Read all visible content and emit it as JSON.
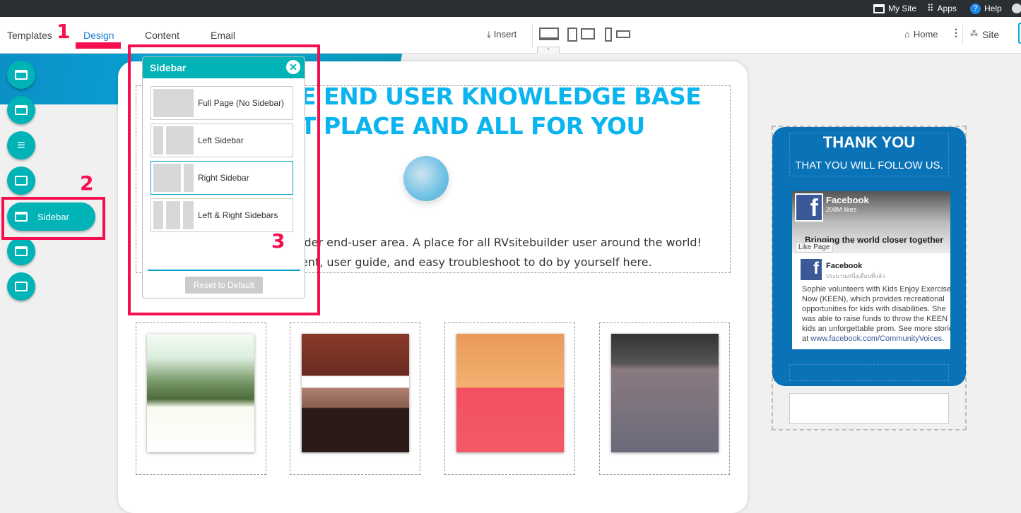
{
  "topbar": {
    "my_site": "My Site",
    "apps": "Apps",
    "help": "Help"
  },
  "toolbar": {
    "tabs": [
      "Templates",
      "Design",
      "Content",
      "Email"
    ],
    "active_tab": "Design",
    "insert": "Insert",
    "home": "Home",
    "site": "Site"
  },
  "annotations": {
    "n1": "1",
    "n2": "2",
    "n3": "3",
    "color": "#f50f4e"
  },
  "rail": {
    "expanded_label": "Sidebar"
  },
  "popup": {
    "title": "Sidebar",
    "options": [
      "Full Page (No Sidebar)",
      "Left Sidebar",
      "Right Sidebar",
      "Left & Right Sidebars"
    ],
    "selected": "Right Sidebar",
    "reset": "Reset to Default"
  },
  "content": {
    "heading1": "E END USER KNOWLEDGE BASE",
    "heading2": "T PLACE AND ALL FOR YOU",
    "para1": "lder end-user area. A place for all RVsitebuilder user around the world!",
    "para2": "ent, user guide, and easy troubleshoot to do by yourself here."
  },
  "sidebar": {
    "title": "THANK YOU",
    "subtitle": "THAT YOU WILL FOLLOW US.",
    "facebook": {
      "name": "Facebook",
      "likes": "208M likes",
      "cover": "Bringing the world closer together",
      "like_page": "Like Page",
      "post_name": "Facebook",
      "post_time": "ประมาณหนึ่งเดือนที่แล้ว",
      "post_text": "Sophie volunteers with Kids Enjoy Exercise Now (KEEN), which provides recreational opportunities for kids with disabilities. She was able to raise funds to throw the KEEN kids an unforgettable prom. See more stories at",
      "post_link": "www.facebook.com/CommunityVoices."
    }
  },
  "colors": {
    "accent": "#00b3b6",
    "heading": "#0ab4ef",
    "sidebar_bg": "#0a73b8",
    "design_tab": "#1a7fd4"
  }
}
